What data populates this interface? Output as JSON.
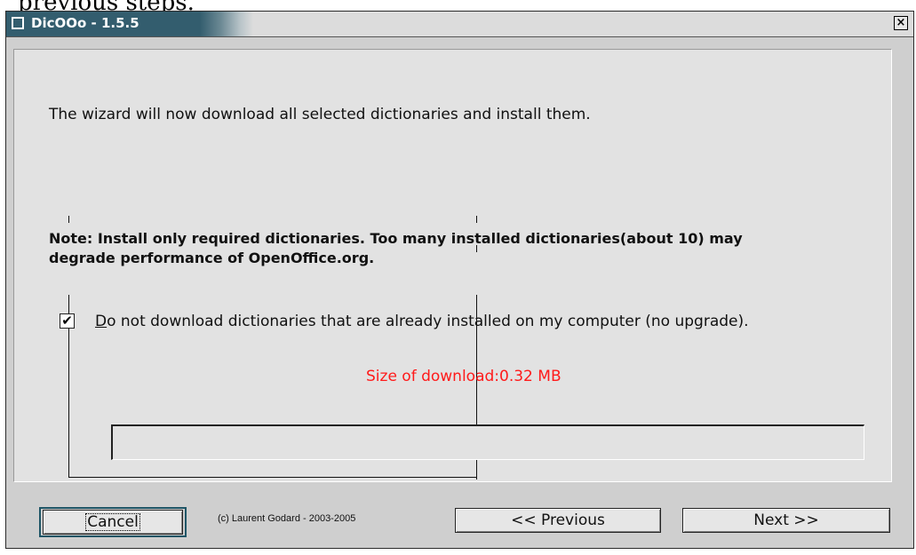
{
  "background_text": "previous steps.",
  "window": {
    "title": "DicOOo - 1.5.5",
    "close_glyph": "×"
  },
  "content": {
    "intro": "The wizard will now download all selected dictionaries and install them.",
    "note_line1": "Note: Install only required dictionaries. Too many installed dictionaries(about 10) may",
    "note_line2": "degrade performance of OpenOffice.org.",
    "checkbox": {
      "checked": true,
      "glyph": "✔",
      "mnemonic": "D",
      "label_rest": "o not download dictionaries that are already installed on my computer (no upgrade)."
    },
    "size_label": "Size of download:0.32 MB",
    "progress_fraction": 0
  },
  "footer": {
    "cancel_label": "Cancel",
    "copyright": "(c) Laurent Godard - 2003-2005",
    "previous_label": "<< Previous",
    "next_label": "Next >>"
  },
  "colors": {
    "title_bar": "#335d6e",
    "size_text": "#ff1a1a",
    "dialog_bg": "#cfcfcf"
  }
}
